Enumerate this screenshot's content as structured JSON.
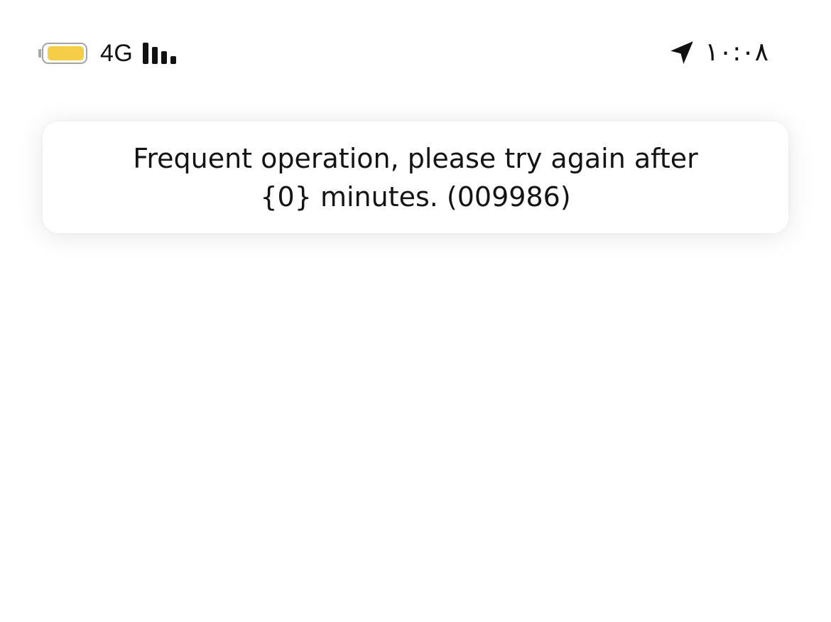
{
  "status_bar": {
    "network": "4G",
    "time": "۱۰:۰۸",
    "icons": {
      "battery": "battery-icon",
      "signal": "signal-bars-icon",
      "location": "location-arrow-icon"
    },
    "battery_color": "#f5cd47",
    "battery_level": 0.95,
    "signal_strength_bars": 4
  },
  "toast": {
    "message": "Frequent operation, please try again after {0} minutes. (009986)"
  }
}
